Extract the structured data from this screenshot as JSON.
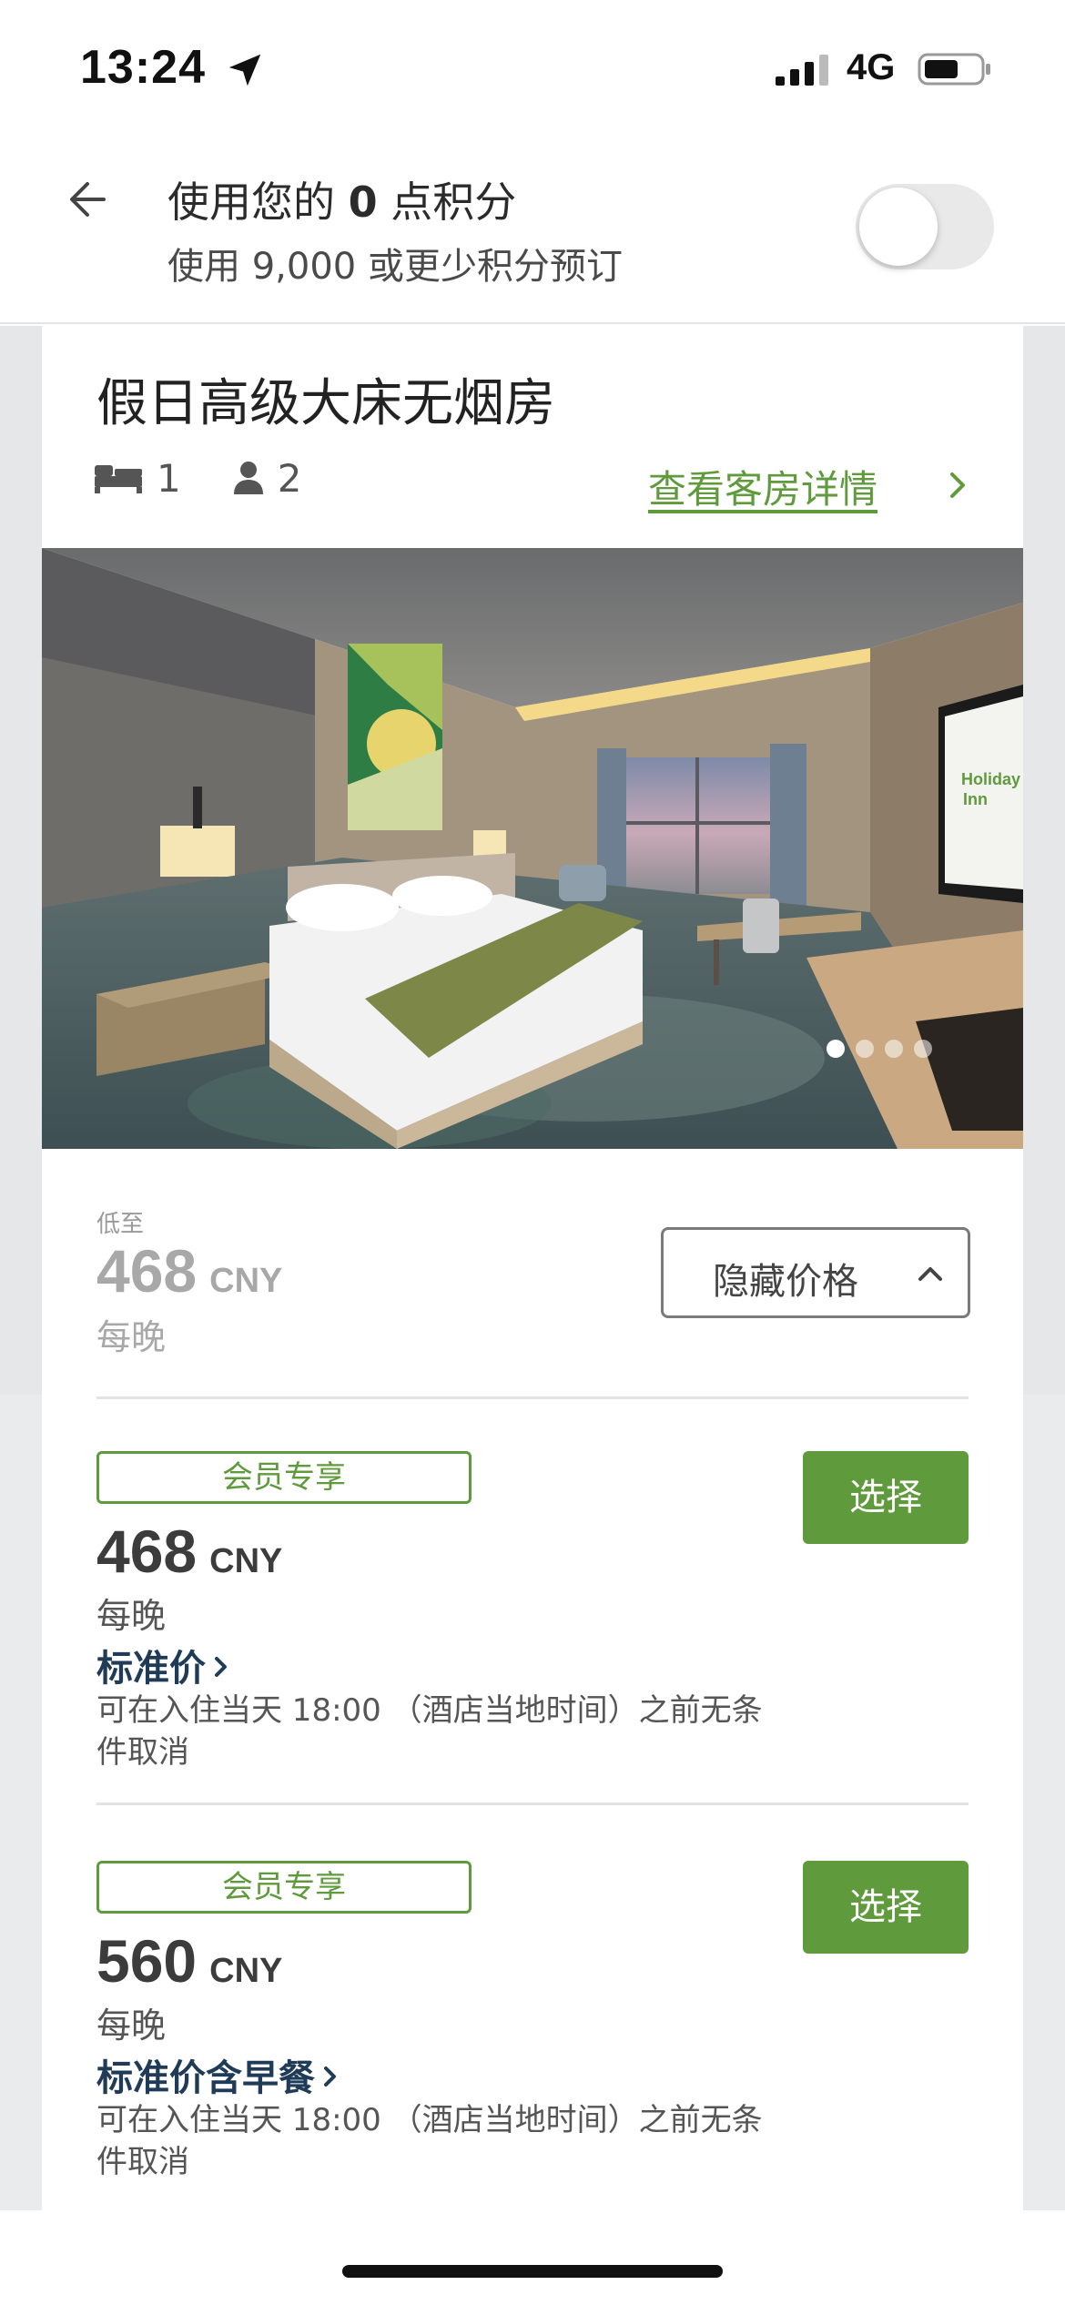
{
  "status_bar": {
    "time": "13:24",
    "network": "4G",
    "icons": [
      "location-arrow-icon",
      "signal-icon",
      "battery-icon"
    ]
  },
  "points": {
    "title_prefix": "使用您的 ",
    "points_value": "0",
    "title_suffix": " 点积分",
    "subtitle": "使用 9,000 或更少积分预订",
    "toggle_on": false
  },
  "room": {
    "title": "假日高级大床无烟房",
    "beds": "1",
    "guests": "2",
    "details_link": "查看客房详情",
    "photo_dots_total": 4,
    "photo_dot_active": 1,
    "tv_logo_text": "假日酒店 Holiday Inn"
  },
  "summary": {
    "from_label": "低至",
    "price": "468",
    "currency": "CNY",
    "per_night": "每晚",
    "hide_prices_label": "隐藏价格"
  },
  "rates": [
    {
      "badge": "会员专享",
      "price": "468",
      "currency": "CNY",
      "per_night": "每晚",
      "name": "标准价",
      "policy": "可在入住当天 18:00 （酒店当地时间）之前无条件取消",
      "select_label": "选择"
    },
    {
      "badge": "会员专享",
      "price": "560",
      "currency": "CNY",
      "per_night": "每晚",
      "name": "标准价含早餐",
      "policy": "可在入住当天 18:00 （酒店当地时间）之前无条件取消",
      "select_label": "选择"
    }
  ],
  "colors": {
    "accent_green": "#5f9b3c",
    "rate_name_navy": "#1f3b57",
    "background_gray": "#e5e7e8"
  }
}
